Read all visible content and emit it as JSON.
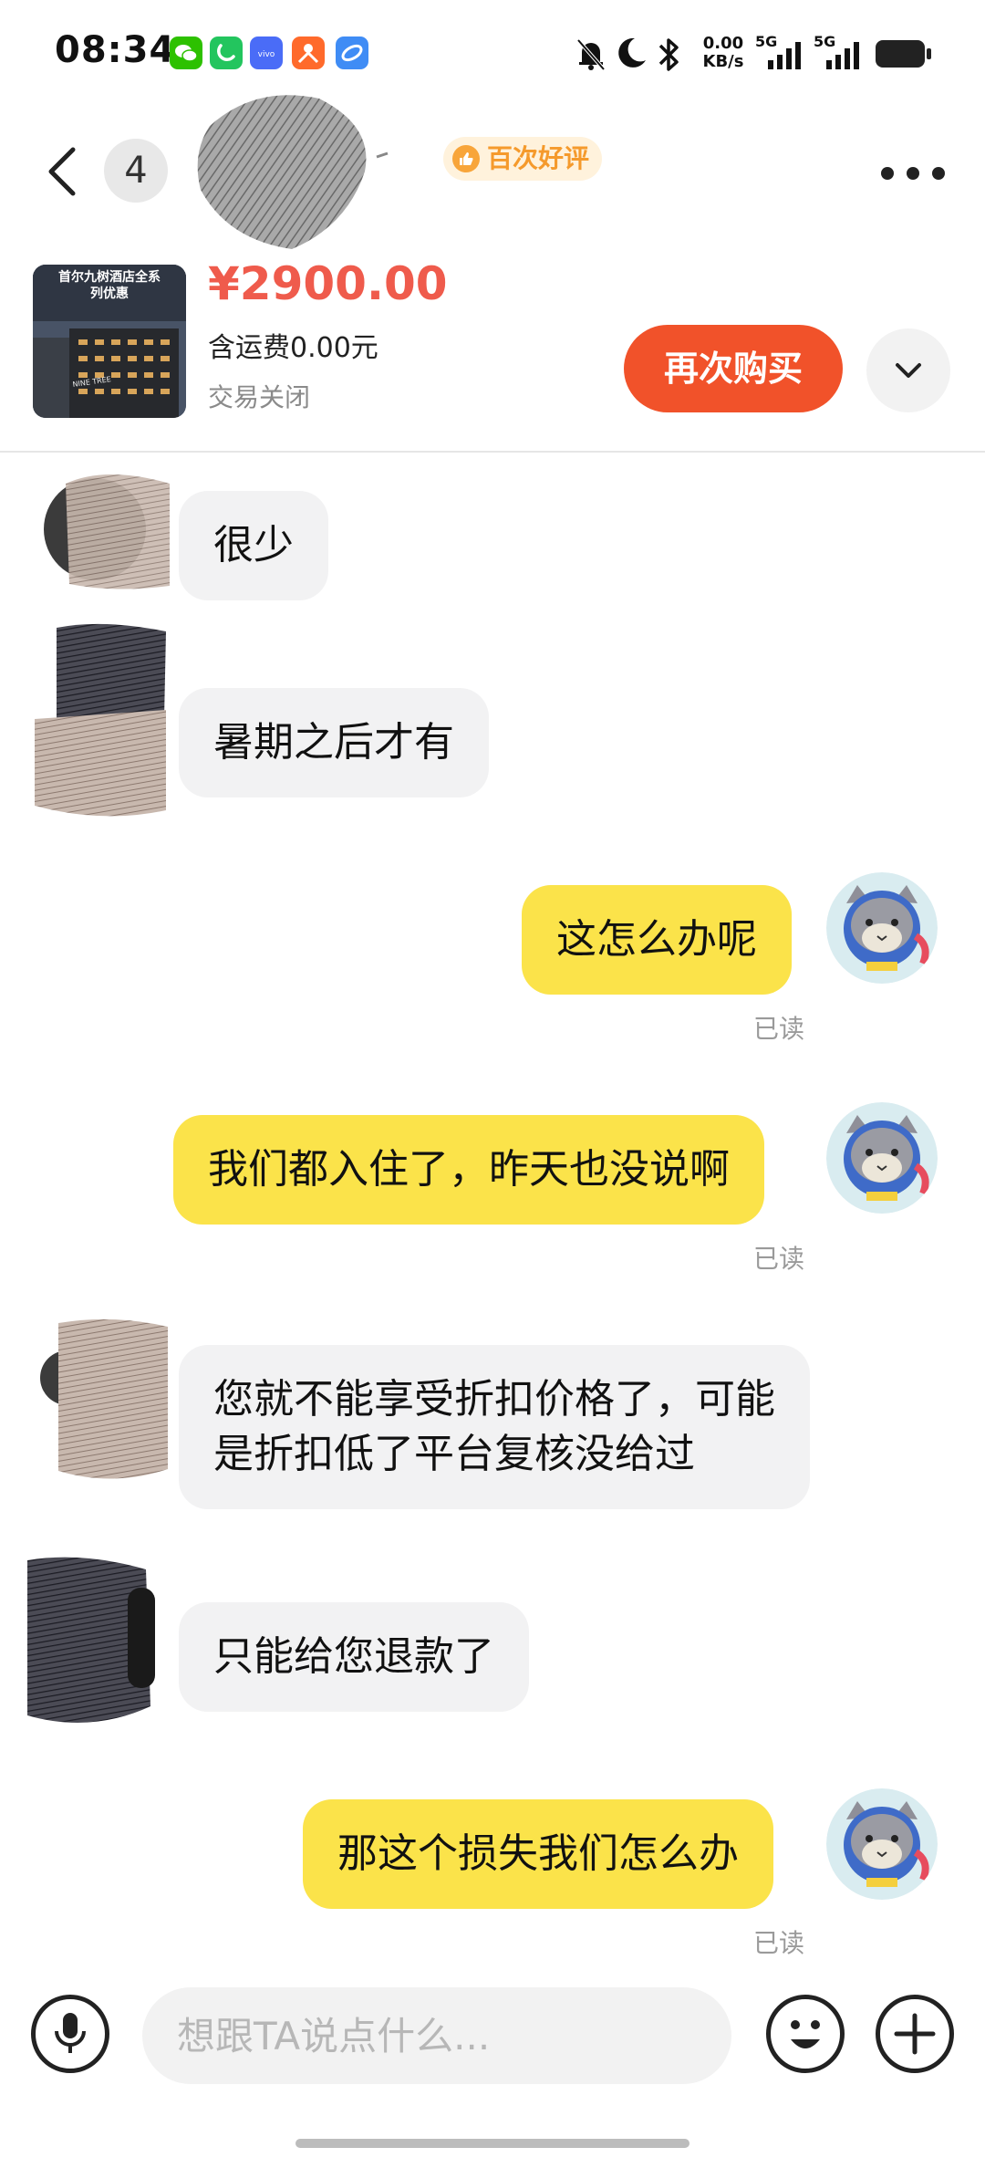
{
  "status_bar": {
    "time": "08:34",
    "net_speed_value": "0.00",
    "net_speed_unit": "KB/s",
    "sim1": "5G",
    "sim2": "5G",
    "app_icons": [
      "wechat-icon",
      "phone-app-icon",
      "vivo-icon",
      "app-promo-icon",
      "browser-icon"
    ]
  },
  "header": {
    "unread_count": "4",
    "badge_label": "百次好评"
  },
  "product": {
    "thumb_text_line1": "首尔九树酒店全系",
    "thumb_text_line2": "列优惠",
    "thumb_sign": "NINE TREE",
    "price": "¥2900.00",
    "shipping": "含运费0.00元",
    "status": "交易关闭",
    "buy_again_label": "再次购买"
  },
  "messages": [
    {
      "side": "left",
      "lines": [
        "很少"
      ]
    },
    {
      "side": "left",
      "lines": [
        "暑期之后才有"
      ]
    },
    {
      "side": "right",
      "lines": [
        "这怎么办呢"
      ],
      "read": "已读"
    },
    {
      "side": "right",
      "lines": [
        "我们都入住了，昨天也没说啊"
      ],
      "read": "已读"
    },
    {
      "side": "left",
      "lines": [
        "您就不能享受折扣价格了，可能",
        "是折扣低了平台复核没给过"
      ]
    },
    {
      "side": "left",
      "lines": [
        "只能给您退款了"
      ]
    },
    {
      "side": "right",
      "lines": [
        "那这个损失我们怎么办"
      ],
      "read": "已读"
    }
  ],
  "input": {
    "placeholder": "想跟TA说点什么..."
  },
  "colors": {
    "accent_price": "#ef5b4c",
    "buy_button": "#f1522a",
    "my_bubble": "#fbe34a",
    "their_bubble": "#f2f2f3"
  }
}
